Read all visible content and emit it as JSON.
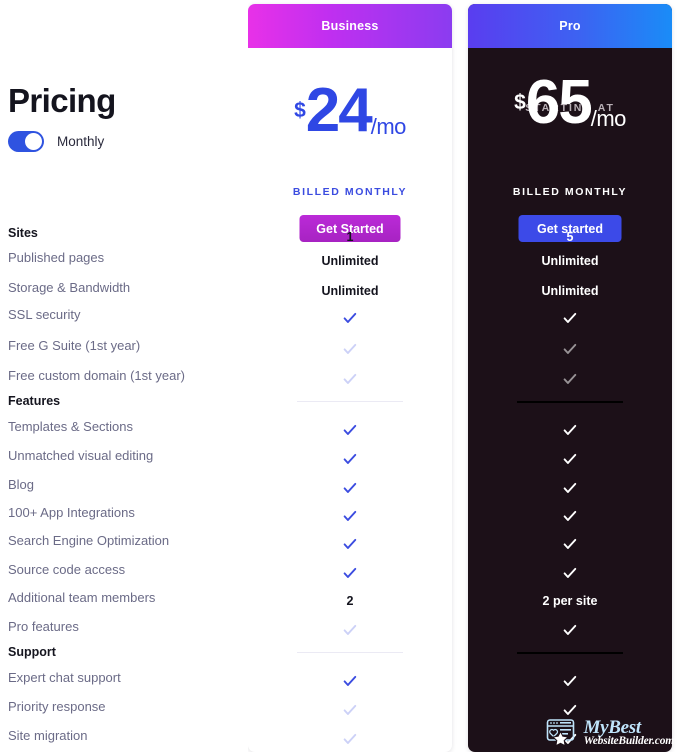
{
  "header": {
    "title": "Pricing",
    "billing_toggle": {
      "label": "Monthly",
      "state": "on",
      "accent_color": "#2f53e0"
    }
  },
  "features": [
    {
      "label": "Sites",
      "group": true
    },
    {
      "label": "Published pages",
      "group": false
    },
    {
      "label": "Storage & Bandwidth",
      "group": false
    },
    {
      "label": "SSL security",
      "group": false
    },
    {
      "label": "Free G Suite (1st year)",
      "group": false
    },
    {
      "label": "Free custom domain (1st year)",
      "group": false
    },
    {
      "label": "Features",
      "group": true
    },
    {
      "label": "Templates & Sections",
      "group": false
    },
    {
      "label": "Unmatched visual editing",
      "group": false
    },
    {
      "label": "Blog",
      "group": false
    },
    {
      "label": "100+ App Integrations",
      "group": false
    },
    {
      "label": "Search Engine Optimization",
      "group": false
    },
    {
      "label": "Source code access",
      "group": false
    },
    {
      "label": "Additional team members",
      "group": false
    },
    {
      "label": "Pro features",
      "group": false
    },
    {
      "label": "Support",
      "group": true
    },
    {
      "label": "Expert chat support",
      "group": false
    },
    {
      "label": "Priority response",
      "group": false
    },
    {
      "label": "Site migration",
      "group": false
    }
  ],
  "plans": [
    {
      "id": "business",
      "name": "Business",
      "starting_at": "",
      "currency": "$",
      "amount": "24",
      "period": "/mo",
      "billed_note": "BILLED MONTHLY",
      "cta_label": "Get Started",
      "header_gradient_from": "#e831e8",
      "header_gradient_to": "#8b3cf0",
      "cta_color": "#b42ad0",
      "accent_color": "#2f47e4",
      "values": [
        {
          "type": "text",
          "text": "1"
        },
        {
          "type": "text",
          "text": "Unlimited"
        },
        {
          "type": "text",
          "text": "Unlimited"
        },
        {
          "type": "check",
          "state": "on"
        },
        {
          "type": "check",
          "state": "off"
        },
        {
          "type": "check",
          "state": "off"
        },
        {
          "type": "divider"
        },
        {
          "type": "check",
          "state": "on"
        },
        {
          "type": "check",
          "state": "on"
        },
        {
          "type": "check",
          "state": "on"
        },
        {
          "type": "check",
          "state": "on"
        },
        {
          "type": "check",
          "state": "on"
        },
        {
          "type": "check",
          "state": "on"
        },
        {
          "type": "text",
          "text": "2"
        },
        {
          "type": "check",
          "state": "off"
        },
        {
          "type": "divider"
        },
        {
          "type": "check",
          "state": "on"
        },
        {
          "type": "check",
          "state": "off"
        },
        {
          "type": "check",
          "state": "off"
        }
      ]
    },
    {
      "id": "pro",
      "name": "Pro",
      "starting_at": "STARTING AT",
      "currency": "$",
      "amount": "65",
      "period": "/mo",
      "billed_note": "BILLED MONTHLY",
      "cta_label": "Get started",
      "header_gradient_from": "#5a3df0",
      "header_gradient_to": "#1a8cf7",
      "cta_color": "#3c4ae8",
      "accent_color": "#ffffff",
      "values": [
        {
          "type": "text",
          "text": "5"
        },
        {
          "type": "text",
          "text": "Unlimited"
        },
        {
          "type": "text",
          "text": "Unlimited"
        },
        {
          "type": "check",
          "state": "on"
        },
        {
          "type": "check",
          "state": "dim"
        },
        {
          "type": "check",
          "state": "dim"
        },
        {
          "type": "divider"
        },
        {
          "type": "check",
          "state": "on"
        },
        {
          "type": "check",
          "state": "on"
        },
        {
          "type": "check",
          "state": "on"
        },
        {
          "type": "check",
          "state": "on"
        },
        {
          "type": "check",
          "state": "on"
        },
        {
          "type": "check",
          "state": "on"
        },
        {
          "type": "text",
          "text": "2 per site"
        },
        {
          "type": "check",
          "state": "on"
        },
        {
          "type": "divider"
        },
        {
          "type": "check",
          "state": "on"
        },
        {
          "type": "check",
          "state": "on"
        },
        {
          "type": "check",
          "state": "on"
        }
      ]
    }
  ],
  "watermark": {
    "line1": "MyBest",
    "line2": "WebsiteBuilder.com"
  }
}
